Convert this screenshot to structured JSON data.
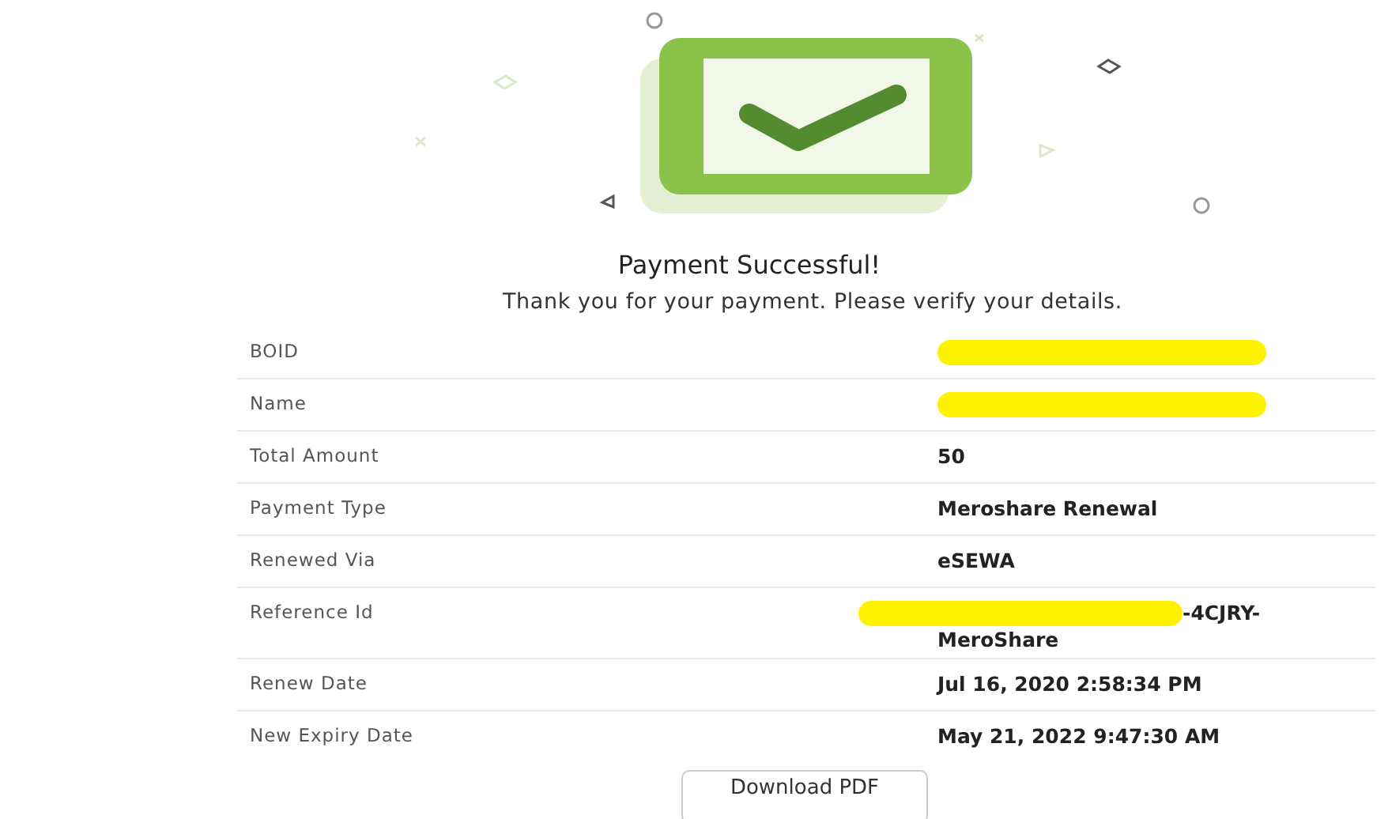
{
  "title": "Payment Successful!",
  "subtitle": "Thank you for your payment. Please verify your details.",
  "rows": [
    {
      "label": "BOID",
      "value": "",
      "redacted": true
    },
    {
      "label": "Name",
      "value": "",
      "redacted": true
    },
    {
      "label": "Total Amount",
      "value": "50",
      "redacted": false
    },
    {
      "label": "Payment Type",
      "value": "Meroshare Renewal",
      "redacted": false
    },
    {
      "label": "Renewed Via",
      "value": "eSEWA",
      "redacted": false
    },
    {
      "label": "Reference Id",
      "value": "-4CJRY-MeroShare",
      "redacted": true
    },
    {
      "label": "Renew Date",
      "value": "Jul 16, 2020 2:58:34 PM",
      "redacted": false
    },
    {
      "label": "New Expiry Date",
      "value": "May 21, 2022 9:47:30 AM",
      "redacted": false
    }
  ],
  "button": "Download PDF"
}
